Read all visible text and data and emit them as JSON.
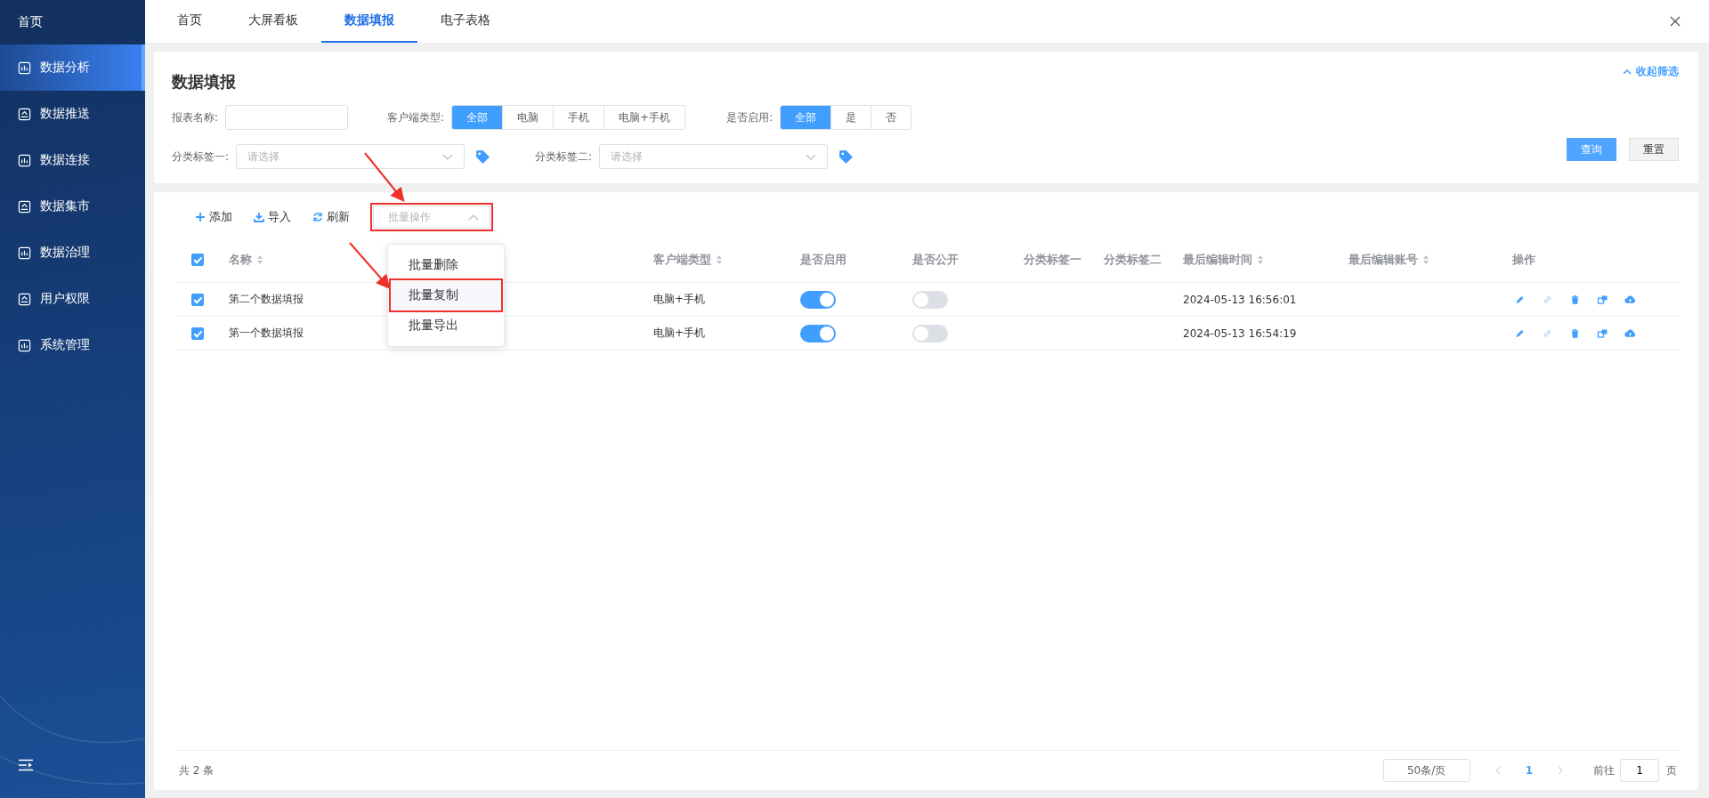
{
  "sidebar": {
    "header": "首页",
    "items": [
      {
        "label": "数据分析",
        "selected": true
      },
      {
        "label": "数据推送",
        "selected": false
      },
      {
        "label": "数据连接",
        "selected": false
      },
      {
        "label": "数据集市",
        "selected": false
      },
      {
        "label": "数据治理",
        "selected": false
      },
      {
        "label": "用户权限",
        "selected": false
      },
      {
        "label": "系统管理",
        "selected": false
      }
    ]
  },
  "tabs": [
    {
      "label": "首页",
      "selected": false
    },
    {
      "label": "大屏看板",
      "selected": false
    },
    {
      "label": "数据填报",
      "selected": true
    },
    {
      "label": "电子表格",
      "selected": false
    }
  ],
  "filter_panel": {
    "title": "数据填报",
    "collapse_link": "收起筛选",
    "report_name": {
      "label": "报表名称:"
    },
    "client_type": {
      "label": "客户端类型:",
      "options": [
        {
          "label": "全部",
          "selected": true
        },
        {
          "label": "电脑",
          "selected": false
        },
        {
          "label": "手机",
          "selected": false
        },
        {
          "label": "电脑+手机",
          "selected": false
        }
      ]
    },
    "enabled": {
      "label": "是否启用:",
      "options": [
        {
          "label": "全部",
          "selected": true
        },
        {
          "label": "是",
          "selected": false
        },
        {
          "label": "否",
          "selected": false
        }
      ]
    },
    "tag_one": {
      "label": "分类标签一:",
      "placeholder": "请选择"
    },
    "tag_two": {
      "label": "分类标签二:",
      "placeholder": "请选择"
    },
    "buttons": [
      {
        "label": "查询",
        "kind": "primary"
      },
      {
        "label": "重置",
        "kind": "default"
      }
    ]
  },
  "toolbar": {
    "actions": [
      {
        "label": "添加",
        "kind": "add"
      },
      {
        "label": "导入",
        "kind": "import"
      },
      {
        "label": "刷新",
        "kind": "refresh"
      }
    ],
    "batch": {
      "placeholder": "批量操作",
      "expanded": true,
      "highlighted": true,
      "menu": [
        {
          "label": "批量删除",
          "highlighted": false
        },
        {
          "label": "批量复制",
          "highlighted": true
        },
        {
          "label": "批量导出",
          "highlighted": false
        }
      ]
    }
  },
  "table": {
    "select_all": true,
    "columns": [
      {
        "label": "名称",
        "sortable": true
      },
      {
        "label": "客户端类型",
        "sortable": true
      },
      {
        "label": "是否启用",
        "sortable": false
      },
      {
        "label": "是否公开",
        "sortable": false
      },
      {
        "label": "分类标签一",
        "sortable": false
      },
      {
        "label": "分类标签二",
        "sortable": false
      },
      {
        "label": "最后编辑时间",
        "sortable": true
      },
      {
        "label": "最后编辑账号",
        "sortable": true
      },
      {
        "label": "操作",
        "sortable": false
      }
    ],
    "rows": [
      {
        "checked": true,
        "name": "第二个数据填报",
        "client": "电脑+手机",
        "enabled": true,
        "public": false,
        "edited": "2024-05-13 16:56:01"
      },
      {
        "checked": true,
        "name": "第一个数据填报",
        "client": "电脑+手机",
        "enabled": true,
        "public": false,
        "edited": "2024-05-13 16:54:19"
      }
    ]
  },
  "footer": {
    "total": "共 2 条",
    "page_size": "50条/页",
    "pages": [
      {
        "label": "1",
        "selected": true
      }
    ],
    "goto_label": "前往",
    "goto_value": "1",
    "page_suffix": "页"
  }
}
